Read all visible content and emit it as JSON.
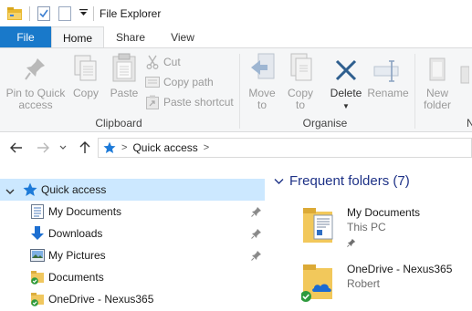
{
  "window": {
    "title": "File Explorer"
  },
  "ribbon_tabs": [
    {
      "label": "File"
    },
    {
      "label": "Home"
    },
    {
      "label": "Share"
    },
    {
      "label": "View"
    }
  ],
  "clipboard": {
    "pin_label_1": "Pin to Quick",
    "pin_label_2": "access",
    "copy": "Copy",
    "paste": "Paste",
    "cut": "Cut",
    "copy_path": "Copy path",
    "paste_shortcut": "Paste shortcut",
    "group": "Clipboard"
  },
  "organise": {
    "move_to_1": "Move",
    "move_to_2": "to",
    "copy_to_1": "Copy",
    "copy_to_2": "to",
    "delete": "Delete",
    "rename": "Rename",
    "group": "Organise"
  },
  "new": {
    "label_1": "New",
    "label_2": "folder",
    "group_initial": "N"
  },
  "address": {
    "crumb": "Quick access"
  },
  "nav_items": [
    {
      "label": "Quick access",
      "icon": "star-icon"
    },
    {
      "label": "My Documents",
      "icon": "document-icon"
    },
    {
      "label": "Downloads",
      "icon": "download-arrow-icon"
    },
    {
      "label": "My Pictures",
      "icon": "pictures-icon"
    },
    {
      "label": "Documents",
      "icon": "folder-sync-icon"
    },
    {
      "label": "OneDrive - Nexus365",
      "icon": "onedrive-folder-icon"
    }
  ],
  "frequent": {
    "heading": "Frequent folders (7)",
    "items": [
      {
        "name": "My Documents",
        "location": "This PC"
      },
      {
        "name": "OneDrive - Nexus365",
        "location": "Robert"
      }
    ]
  },
  "colors": {
    "accent": "#1979ca",
    "selection": "#cce8ff",
    "heading": "#1e3287"
  }
}
